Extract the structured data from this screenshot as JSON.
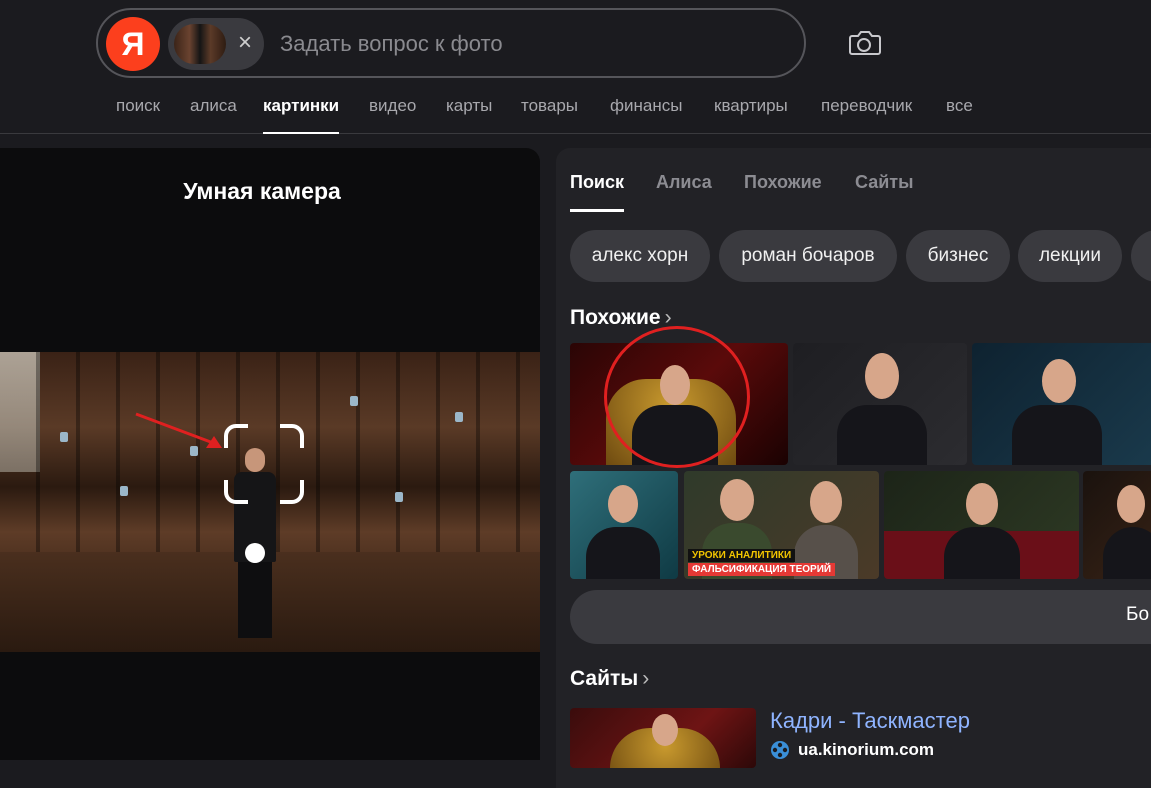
{
  "header": {
    "logo_letter": "Я",
    "search_placeholder": "Задать вопрос к фото",
    "chip_close": "×"
  },
  "nav": {
    "items": [
      {
        "label": "поиск",
        "active": false
      },
      {
        "label": "алиса",
        "active": false
      },
      {
        "label": "картинки",
        "active": true
      },
      {
        "label": "видео",
        "active": false
      },
      {
        "label": "карты",
        "active": false
      },
      {
        "label": "товары",
        "active": false
      },
      {
        "label": "финансы",
        "active": false
      },
      {
        "label": "квартиры",
        "active": false
      },
      {
        "label": "переводчик",
        "active": false
      },
      {
        "label": "все",
        "active": false
      }
    ]
  },
  "left": {
    "title": "Умная камера"
  },
  "right": {
    "tabs": [
      {
        "label": "Поиск",
        "active": true
      },
      {
        "label": "Алиса",
        "active": false
      },
      {
        "label": "Похожие",
        "active": false
      },
      {
        "label": "Сайты",
        "active": false
      }
    ],
    "tags": [
      "алекс хорн",
      "роман бочаров",
      "бизнес",
      "лекции"
    ],
    "similar_title": "Похожие",
    "tile_caption_1": "УРОКИ АНАЛИТИКИ",
    "tile_caption_2": "ФАЛЬСИФИКАЦИЯ ТЕОРИЙ",
    "more_label": "Бо",
    "sites_title": "Сайты",
    "site": {
      "title": "Кадри - Таскмастер",
      "domain": "ua.kinorium.com"
    }
  },
  "colors": {
    "brand": "#fc3f1d",
    "link": "#8fb4ff",
    "annotation": "#e02020"
  }
}
